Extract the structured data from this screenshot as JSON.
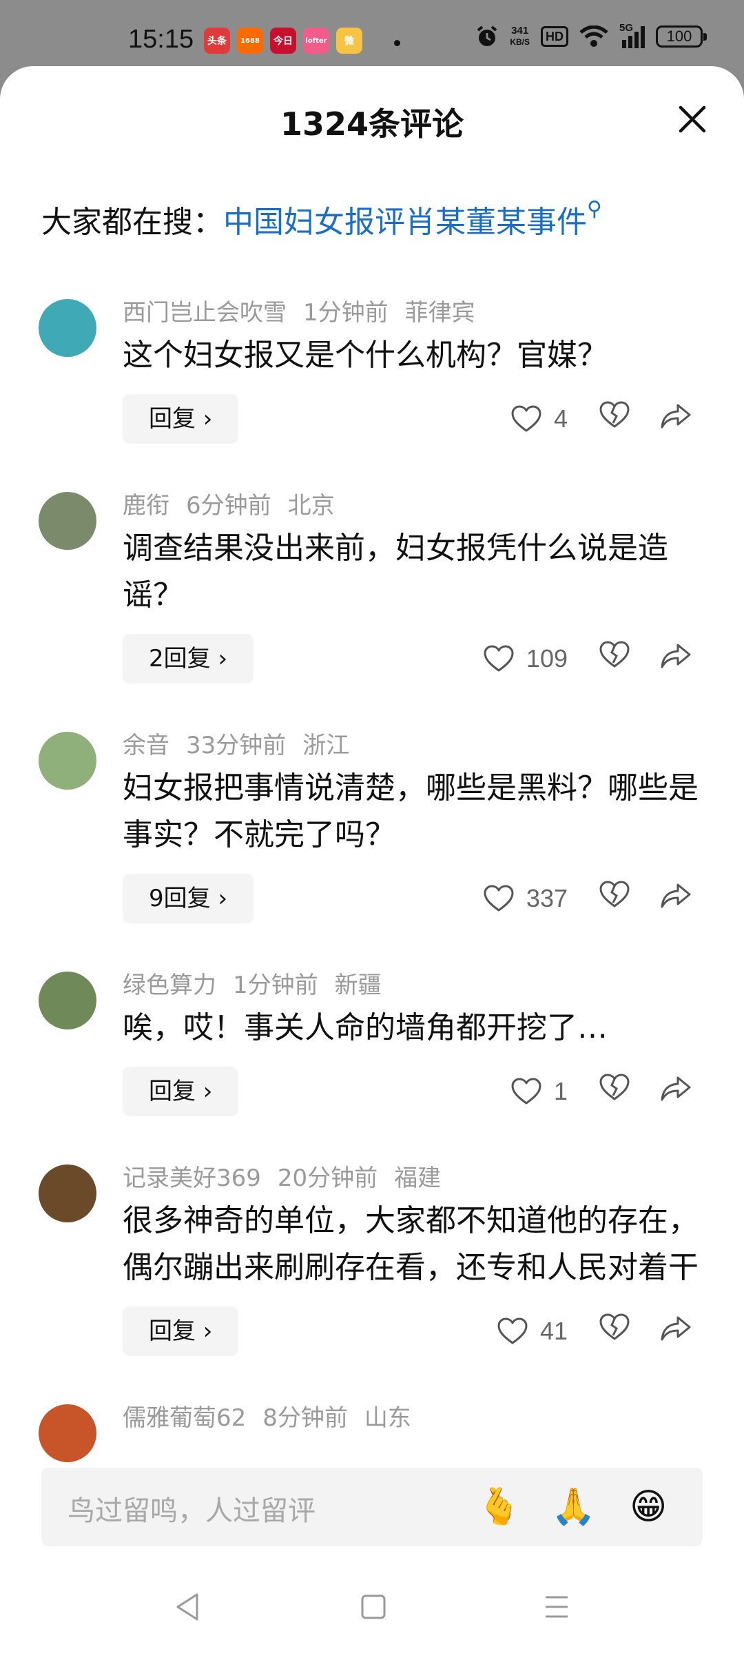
{
  "status_bar": {
    "time": "15:15",
    "app_badges": [
      {
        "name": "toutiao-icon",
        "text": "头条",
        "color": "#e03a3a"
      },
      {
        "name": "alibaba-1688-icon",
        "text": "1688",
        "color": "#ff6a00"
      },
      {
        "name": "news-app-icon",
        "text": "今日",
        "color": "#c8102e"
      },
      {
        "name": "lofter-icon",
        "text": "lofter",
        "color": "#f25c8a"
      },
      {
        "name": "weibo-icon",
        "text": "微",
        "color": "#f6c343"
      }
    ],
    "net_speed_value": "341",
    "net_speed_unit": "KB/S",
    "hd": "HD",
    "signal": "5G",
    "battery": "100"
  },
  "header": {
    "title": "1324条评论"
  },
  "search_hint": {
    "prefix": "大家都在搜：",
    "topic": "中国妇女报评肖某董某事件"
  },
  "comments": [
    {
      "user": "西门岂止会吹雪",
      "time": "1分钟前",
      "location": "菲律宾",
      "text": "这个妇女报又是个什么机构？官媒？",
      "reply": "回复 ›",
      "likes": "4",
      "avatar_color": "#3fa9b5"
    },
    {
      "user": "鹿衔",
      "time": "6分钟前",
      "location": "北京",
      "text": "调查结果没出来前，妇女报凭什么说是造谣？",
      "reply": "2回复 ›",
      "likes": "109",
      "avatar_color": "#7b8a6a"
    },
    {
      "user": "余音",
      "time": "33分钟前",
      "location": "浙江",
      "text": "妇女报把事情说清楚，哪些是黑料？哪些是事实？不就完了吗？",
      "reply": "9回复 ›",
      "likes": "337",
      "avatar_color": "#8fb07a"
    },
    {
      "user": "绿色算力",
      "time": "1分钟前",
      "location": "新疆",
      "text": "唉，哎！事关人命的墙角都开挖了…",
      "reply": "回复 ›",
      "likes": "1",
      "avatar_color": "#6f8a58"
    },
    {
      "user": "记录美好369",
      "time": "20分钟前",
      "location": "福建",
      "text": "很多神奇的单位，大家都不知道他的存在，偶尔蹦出来刷刷存在看，还专和人民对着干",
      "reply": "回复 ›",
      "likes": "41",
      "avatar_color": "#6b4a2a"
    },
    {
      "user": "儒雅葡萄62",
      "time": "8分钟前",
      "location": "山东",
      "text": "",
      "reply": "",
      "likes": "",
      "avatar_color": "#c8552a"
    }
  ],
  "input_bar": {
    "placeholder": "鸟过留鸣，人过留评",
    "emojis": [
      "🫰",
      "🙏",
      "😁"
    ]
  }
}
